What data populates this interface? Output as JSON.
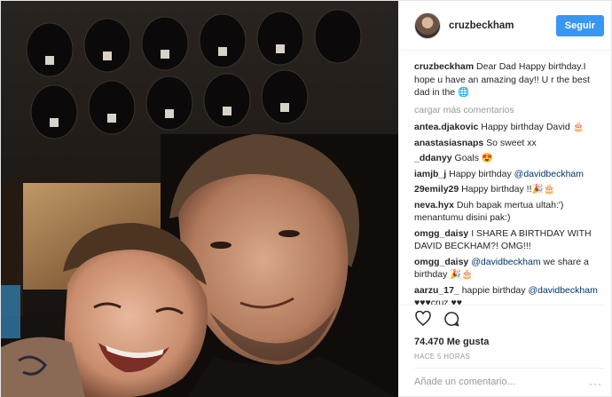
{
  "header": {
    "username": "cruzbeckham",
    "follow_label": "Seguir"
  },
  "caption": {
    "author": "cruzbeckham",
    "text": "Dear Dad Happy birthday.I hope u have an amazing day!! U r the best dad in the 🌐"
  },
  "load_more_label": "cargar más comentarios",
  "comments": [
    {
      "author": "antea.djakovic",
      "text": "Happy birthday David 🎂",
      "mention": "",
      "tail": ""
    },
    {
      "author": "anastasiasnaps",
      "text": "So sweet xx",
      "mention": "",
      "tail": ""
    },
    {
      "author": "_ddanyy",
      "text": "Goals 😍",
      "mention": "",
      "tail": ""
    },
    {
      "author": "iamjb_j",
      "text": "Happy birthday ",
      "mention": "@davidbeckham",
      "tail": ""
    },
    {
      "author": "29emily29",
      "text": "Happy birthday !!🎉🎂",
      "mention": "",
      "tail": ""
    },
    {
      "author": "neva.hyx",
      "text": "Duh bapak mertua ultah:') menantumu disini pak:)",
      "mention": "",
      "tail": ""
    },
    {
      "author": "omgg_daisy",
      "text": "I SHARE A BIRTHDAY WITH DAVID BECKHAM?! OMG!!!",
      "mention": "",
      "tail": ""
    },
    {
      "author": "omgg_daisy",
      "text": "",
      "mention": "@davidbeckham",
      "tail": " we share a birthday 🎉🎂"
    },
    {
      "author": "aarzu_17_",
      "text": "happie birthday ",
      "mention": "@davidbeckham",
      "tail": " ♥♥♥cruz ♥♥"
    }
  ],
  "likes_text": "74.470 Me gusta",
  "time_text": "HACE 5 HORAS",
  "add_comment": {
    "placeholder": "Añade un comentario..."
  },
  "more_text": "···",
  "icons": [
    "heart-icon",
    "comment-icon",
    "more-options-icon"
  ],
  "colors": {
    "accent": "#3897f0",
    "text": "#262626",
    "muted": "#999999",
    "mention": "#003569"
  }
}
